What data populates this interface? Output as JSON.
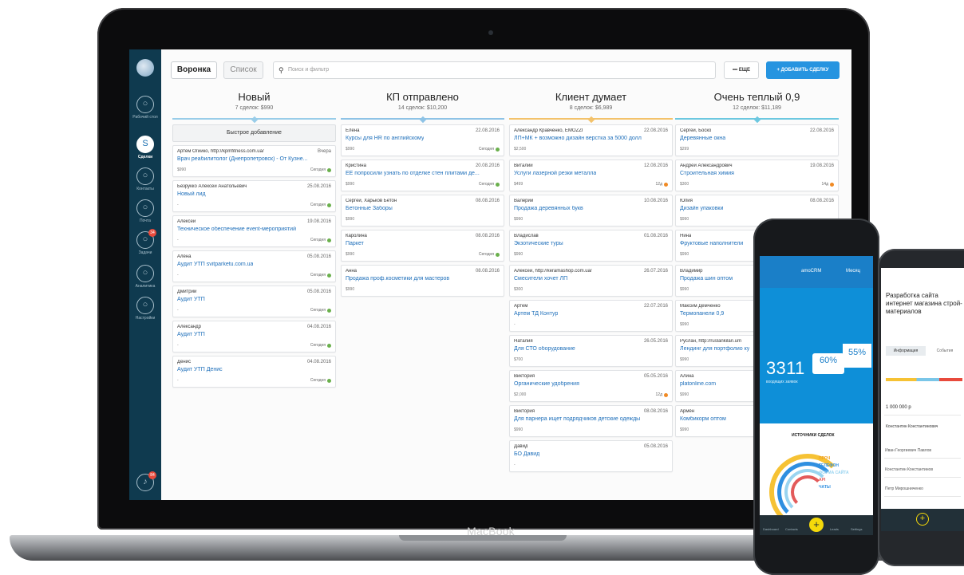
{
  "device_label": "MacBook",
  "toolbar": {
    "view_funnel": "Воронка",
    "view_list": "Список",
    "search_placeholder": "Поиск и фильтр",
    "more_label": "••• ЕЩЕ",
    "add_label": "+ ДОБАВИТЬ СДЕЛКУ"
  },
  "sidebar": [
    {
      "label": "Рабочий стол",
      "icon": "dashboard-icon",
      "active": false
    },
    {
      "label": "Сделки",
      "icon": "deals-icon",
      "active": true
    },
    {
      "label": "Контакты",
      "icon": "contacts-icon",
      "active": false
    },
    {
      "label": "Почта",
      "icon": "mail-icon",
      "active": false
    },
    {
      "label": "Задачи",
      "icon": "tasks-icon",
      "active": false,
      "badge": "34"
    },
    {
      "label": "Аналитика",
      "icon": "analytics-icon",
      "active": false
    },
    {
      "label": "Настройки",
      "icon": "settings-icon",
      "active": false
    }
  ],
  "notification_badge": "84",
  "quick_add": "Быстрое добавление",
  "colors": {
    "today": "#6ab04c",
    "overdue": "#f08a24",
    "accent": "#2694e0"
  },
  "columns": [
    {
      "title": "Новый",
      "summary": "7 сделок: $990",
      "color": "#99cde9",
      "cards": [
        {
          "contact": "Артем Огийко, http://kpmfitness.com.ua/",
          "date": "Вчера",
          "name": "Врач реабилитолог (Днепропетровск) - От Кузне...",
          "price": "$990",
          "status": "Сегодня",
          "dot": "#6ab04c"
        },
        {
          "contact": "Безрукко Алексей Анатольевич",
          "date": "25.08.2016",
          "name": "Новый лид",
          "price": "-",
          "status": "Сегодня",
          "dot": "#6ab04c"
        },
        {
          "contact": "Алексей",
          "date": "19.08.2016",
          "name": "Техническое обеспечение event-мероприятий",
          "price": "-",
          "status": "Сегодня",
          "dot": "#6ab04c"
        },
        {
          "contact": "Алёна",
          "date": "05.08.2016",
          "name": "Аудит УТП svitparketu.com.ua",
          "price": "-",
          "status": "Сегодня",
          "dot": "#6ab04c"
        },
        {
          "contact": "Дмитрий",
          "date": "05.08.2016",
          "name": "Аудит УТП",
          "price": "-",
          "status": "Сегодня",
          "dot": "#6ab04c"
        },
        {
          "contact": "Александр",
          "date": "04.08.2016",
          "name": "Аудит УТП",
          "price": "-",
          "status": "Сегодня",
          "dot": "#6ab04c"
        },
        {
          "contact": "Денис",
          "date": "04.08.2016",
          "name": "Аудит УТП Денис",
          "price": "-",
          "status": "Сегодня",
          "dot": "#6ab04c"
        }
      ]
    },
    {
      "title": "КП отправлено",
      "summary": "14 сделок: $10,200",
      "color": "#8ec3e6",
      "cards": [
        {
          "contact": "Елена",
          "date": "22.08.2016",
          "name": "Курсы для HR по английскому",
          "price": "$990",
          "status": "Сегодня",
          "dot": "#6ab04c"
        },
        {
          "contact": "Кристина",
          "date": "20.08.2016",
          "name": "ЕЕ попросили узнать по отделке стен плитами де...",
          "price": "$990",
          "status": "Сегодня",
          "dot": "#6ab04c"
        },
        {
          "contact": "Сергей, Харьков Бетон",
          "date": "08.08.2016",
          "name": "Бетонные Заборы",
          "price": "$990",
          "status": "",
          "dot": ""
        },
        {
          "contact": "Каролина",
          "date": "08.08.2016",
          "name": "Паркет",
          "price": "$990",
          "status": "Сегодня",
          "dot": "#6ab04c"
        },
        {
          "contact": "Анна",
          "date": "08.08.2016",
          "name": "Продажа проф.косметики для мастеров",
          "price": "$990",
          "status": "",
          "dot": ""
        }
      ]
    },
    {
      "title": "Клиент думает",
      "summary": "8 сделок: $6,989",
      "color": "#f3c26b",
      "cards": [
        {
          "contact": "Александр Кравченко, EMOZZI",
          "date": "22.08.2016",
          "name": "ЛП+МК + возможно дизайн верстка за 5000 долл",
          "price": "$2,500",
          "status": "",
          "dot": ""
        },
        {
          "contact": "Виталий",
          "date": "12.08.2016",
          "name": "Услуги лазерной резки металла",
          "price": "$499",
          "status": "12д",
          "dot": "#f08a24"
        },
        {
          "contact": "Валерий",
          "date": "10.08.2016",
          "name": "Продажа деревянных букв",
          "price": "$990",
          "status": "",
          "dot": ""
        },
        {
          "contact": "Владислав",
          "date": "01.08.2016",
          "name": "Экзотические туры",
          "price": "$990",
          "status": "",
          "dot": ""
        },
        {
          "contact": "Алексей, http://keramashop.com.ua/",
          "date": "26.07.2016",
          "name": "Смесители хочет ЛП",
          "price": "$300",
          "status": "",
          "dot": ""
        },
        {
          "contact": "Артем",
          "date": "22.07.2016",
          "name": "Артем ТД Контур",
          "price": "-",
          "status": "",
          "dot": ""
        },
        {
          "contact": "Наталия",
          "date": "26.05.2016",
          "name": "Для СТО оборудование",
          "price": "$700",
          "status": "",
          "dot": ""
        },
        {
          "contact": "Виктория",
          "date": "05.05.2016",
          "name": "Органические удобрения",
          "price": "$2,000",
          "status": "12д",
          "dot": "#f08a24"
        },
        {
          "contact": "Виктория",
          "date": "08.08.2016",
          "name": "Для парнера ищет подрядчиков детские одежды",
          "price": "$990",
          "status": "",
          "dot": ""
        },
        {
          "contact": "Давид",
          "date": "05.08.2016",
          "name": "БО Давид",
          "price": "-",
          "status": "",
          "dot": ""
        }
      ]
    },
    {
      "title": "Очень теплый 0,9",
      "summary": "12 сделок: $11,189",
      "color": "#6cc8e0",
      "cards": [
        {
          "contact": "Сергей, Боско",
          "date": "22.08.2016",
          "name": "Деревянные окна",
          "price": "$299",
          "status": "",
          "dot": ""
        },
        {
          "contact": "Андрей Александрович",
          "date": "19.08.2016",
          "name": "Строительная химия",
          "price": "$300",
          "status": "14д",
          "dot": "#f08a24"
        },
        {
          "contact": "Юлия",
          "date": "08.08.2016",
          "name": "Дизайн упаковки",
          "price": "$990",
          "status": "",
          "dot": ""
        },
        {
          "contact": "Нина",
          "date": "",
          "name": "Фруктовые наполнители",
          "price": "$990",
          "status": "",
          "dot": ""
        },
        {
          "contact": "Владимир",
          "date": "",
          "name": "Продажа шин оптом",
          "price": "$990",
          "status": "",
          "dot": ""
        },
        {
          "contact": "Максим Демченко",
          "date": "",
          "name": "Термопанели 0,9",
          "price": "$990",
          "status": "",
          "dot": ""
        },
        {
          "contact": "Руслан, http://ruslankilan.um",
          "date": "",
          "name": "Лендинг для портфолио ку",
          "price": "$990",
          "status": "",
          "dot": ""
        },
        {
          "contact": "Алина",
          "date": "",
          "name": "platonline.com",
          "price": "$990",
          "status": "",
          "dot": ""
        },
        {
          "contact": "Армён",
          "date": "",
          "name": "Комбикорм оптом",
          "price": "$990",
          "status": "",
          "dot": ""
        }
      ]
    }
  ],
  "phone1": {
    "title": "amoCRM",
    "month": "Месяц",
    "big_number": "3311",
    "big_caption": "входящих заявок",
    "pct_left": "60%",
    "pct_right": "55%",
    "panel_title": "ИСТОЧНИКИ СДЕЛОК",
    "sources": [
      "ПРОЧ",
      "ТЕЛЕФОН",
      "ФОРМА САЙТА",
      "API",
      "ЧАТЫ"
    ],
    "tabs": [
      "Dashboard",
      "Contacts",
      "Leads",
      "Settings"
    ]
  },
  "phone2": {
    "title": "Разработка сайта интернет магазина строй-материалов",
    "tab_main": "Информация",
    "tab_events": "События",
    "budget": "1 000 000 р",
    "responsible": "Константин Константинович",
    "contacts": [
      "Иван Георгиевич Павлов",
      "Константин Константинов",
      "Петр Мирошниченко"
    ]
  }
}
